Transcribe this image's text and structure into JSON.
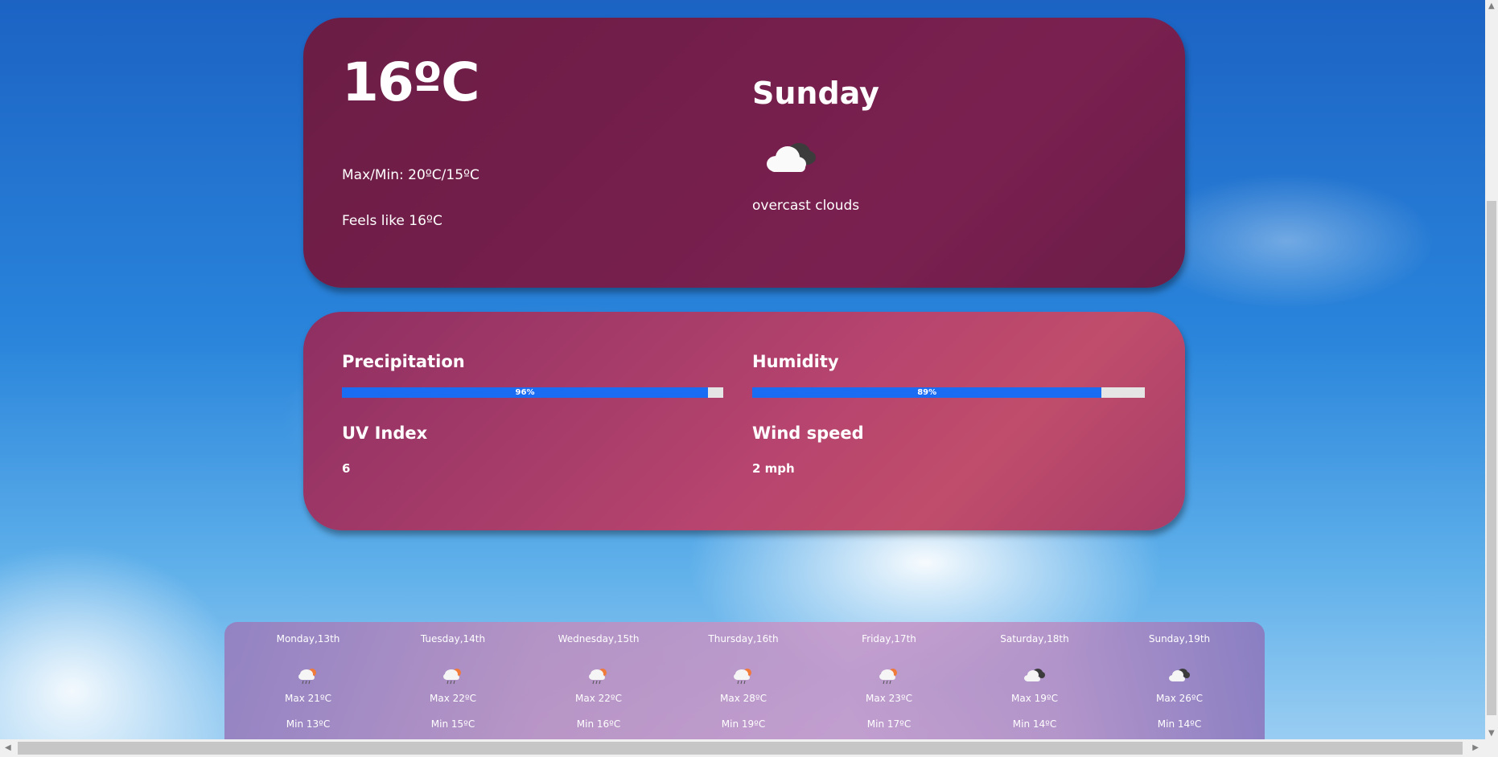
{
  "current": {
    "temperature": "16ºC",
    "max_min": "Max/Min: 20ºC/15ºC",
    "feels_like": "Feels like 16ºC",
    "day": "Sunday",
    "description": "overcast clouds",
    "icon": "overcast-clouds-icon"
  },
  "stats": {
    "precipitation_label": "Precipitation",
    "precipitation_value": "96%",
    "precipitation_fraction": 0.96,
    "humidity_label": "Humidity",
    "humidity_value": "89%",
    "humidity_fraction": 0.89,
    "uv_label": "UV Index",
    "uv_value": "6",
    "wind_label": "Wind speed",
    "wind_value": "2 mph"
  },
  "forecast": [
    {
      "day": "Monday,13th",
      "max": "Max 21ºC",
      "min": "Min 13ºC",
      "icon": "rain-icon"
    },
    {
      "day": "Tuesday,14th",
      "max": "Max 22ºC",
      "min": "Min 15ºC",
      "icon": "rain-icon"
    },
    {
      "day": "Wednesday,15th",
      "max": "Max 22ºC",
      "min": "Min 16ºC",
      "icon": "rain-icon"
    },
    {
      "day": "Thursday,16th",
      "max": "Max 28ºC",
      "min": "Min 19ºC",
      "icon": "rain-icon"
    },
    {
      "day": "Friday,17th",
      "max": "Max 23ºC",
      "min": "Min 17ºC",
      "icon": "rain-icon"
    },
    {
      "day": "Saturday,18th",
      "max": "Max 19ºC",
      "min": "Min 14ºC",
      "icon": "overcast-clouds-icon"
    },
    {
      "day": "Sunday,19th",
      "max": "Max 26ºC",
      "min": "Min 14ºC",
      "icon": "overcast-clouds-icon"
    }
  ],
  "colors": {
    "bar_fill": "#1a6cf2",
    "bar_track": "#e5e5e5",
    "main_card": "#6b1d45",
    "stats_card": "#b6446e"
  }
}
